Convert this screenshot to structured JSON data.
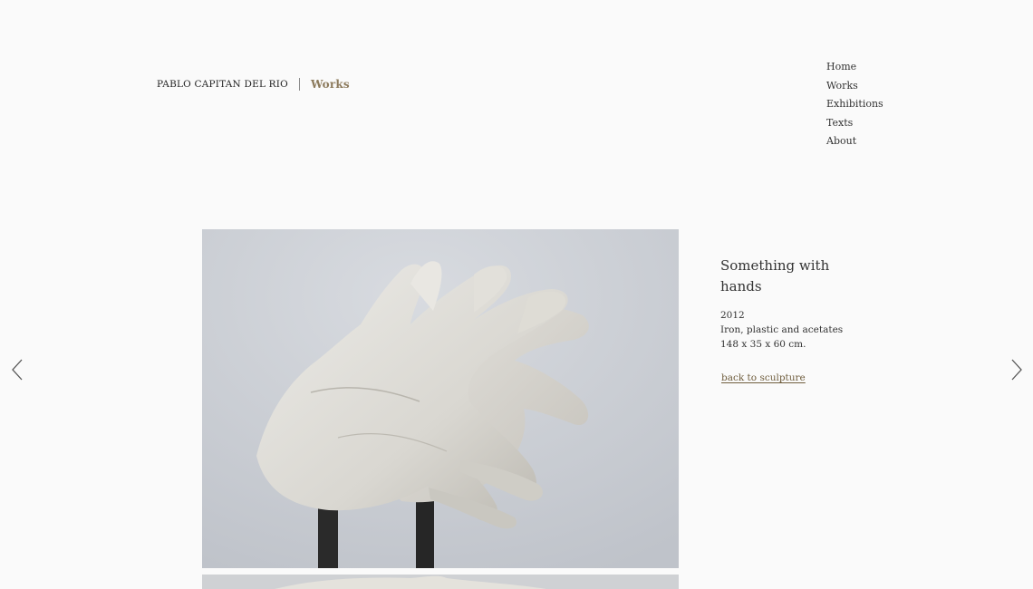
{
  "header": {
    "artist_name": "PABLO CAPITAN DEL RIO",
    "section": "Works"
  },
  "nav": {
    "items": [
      "Home",
      "Works",
      "Exhibitions",
      "Texts",
      "About"
    ]
  },
  "artwork": {
    "title": "Something with hands",
    "year": "2012",
    "materials": "Iron, plastic and acetates",
    "dimensions": "148 x 35 x 60 cm.",
    "back_link": "back to sculpture"
  },
  "icons": {
    "prev": "chevron-left-icon",
    "next": "chevron-right-icon"
  },
  "colors": {
    "accent": "#8c7a5c",
    "link": "#6f5d3d",
    "background": "#fafafa"
  }
}
